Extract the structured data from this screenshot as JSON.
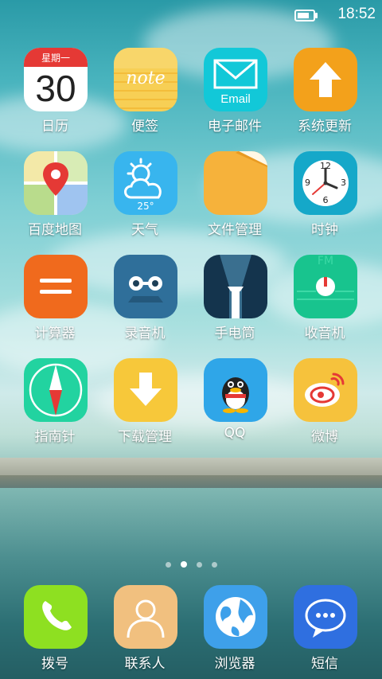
{
  "status_bar": {
    "time": "18:52",
    "battery_level": 0.8
  },
  "apps": [
    {
      "label": "日历",
      "icon": "calendar-icon",
      "day": "30",
      "weekday": "星期一"
    },
    {
      "label": "便签",
      "icon": "notes-icon",
      "text": "note"
    },
    {
      "label": "电子邮件",
      "icon": "email-icon",
      "text": "Email"
    },
    {
      "label": "系统更新",
      "icon": "system-update-icon"
    },
    {
      "label": "百度地图",
      "icon": "map-icon"
    },
    {
      "label": "天气",
      "icon": "weather-icon",
      "temp": "25°"
    },
    {
      "label": "文件管理",
      "icon": "file-manager-icon"
    },
    {
      "label": "时钟",
      "icon": "clock-icon",
      "numbers": [
        "12",
        "3",
        "6",
        "9"
      ]
    },
    {
      "label": "计算器",
      "icon": "calculator-icon"
    },
    {
      "label": "录音机",
      "icon": "recorder-icon"
    },
    {
      "label": "手电筒",
      "icon": "flashlight-icon"
    },
    {
      "label": "收音机",
      "icon": "radio-icon",
      "text": "FM"
    },
    {
      "label": "指南针",
      "icon": "compass-icon"
    },
    {
      "label": "下载管理",
      "icon": "download-manager-icon"
    },
    {
      "label": "QQ",
      "icon": "qq-icon"
    },
    {
      "label": "微博",
      "icon": "weibo-icon"
    }
  ],
  "page_indicator": {
    "count": 4,
    "active": 1
  },
  "dock": [
    {
      "label": "拨号",
      "icon": "phone-icon"
    },
    {
      "label": "联系人",
      "icon": "contacts-icon"
    },
    {
      "label": "浏览器",
      "icon": "browser-icon"
    },
    {
      "label": "短信",
      "icon": "messages-icon"
    }
  ],
  "colors": {
    "calendar_red": "#e53935",
    "notes_yellow": "#f5c542",
    "email_cyan": "#12c8d8",
    "update_orange": "#f3a11b",
    "calculator_orange": "#f06a1d",
    "recorder_blue": "#2f6f9a",
    "flashlight_navy": "#14344d",
    "radio_green": "#18c48e",
    "compass_green": "#22d3a0",
    "download_yellow": "#f7c83a",
    "qq_blue": "#2fa6e8",
    "weibo_yellow": "#f6c23c",
    "phone_green": "#8ee021",
    "contacts_peach": "#f1c07f",
    "browser_blue": "#3ea0ea",
    "messages_blue": "#2f6fe0"
  }
}
